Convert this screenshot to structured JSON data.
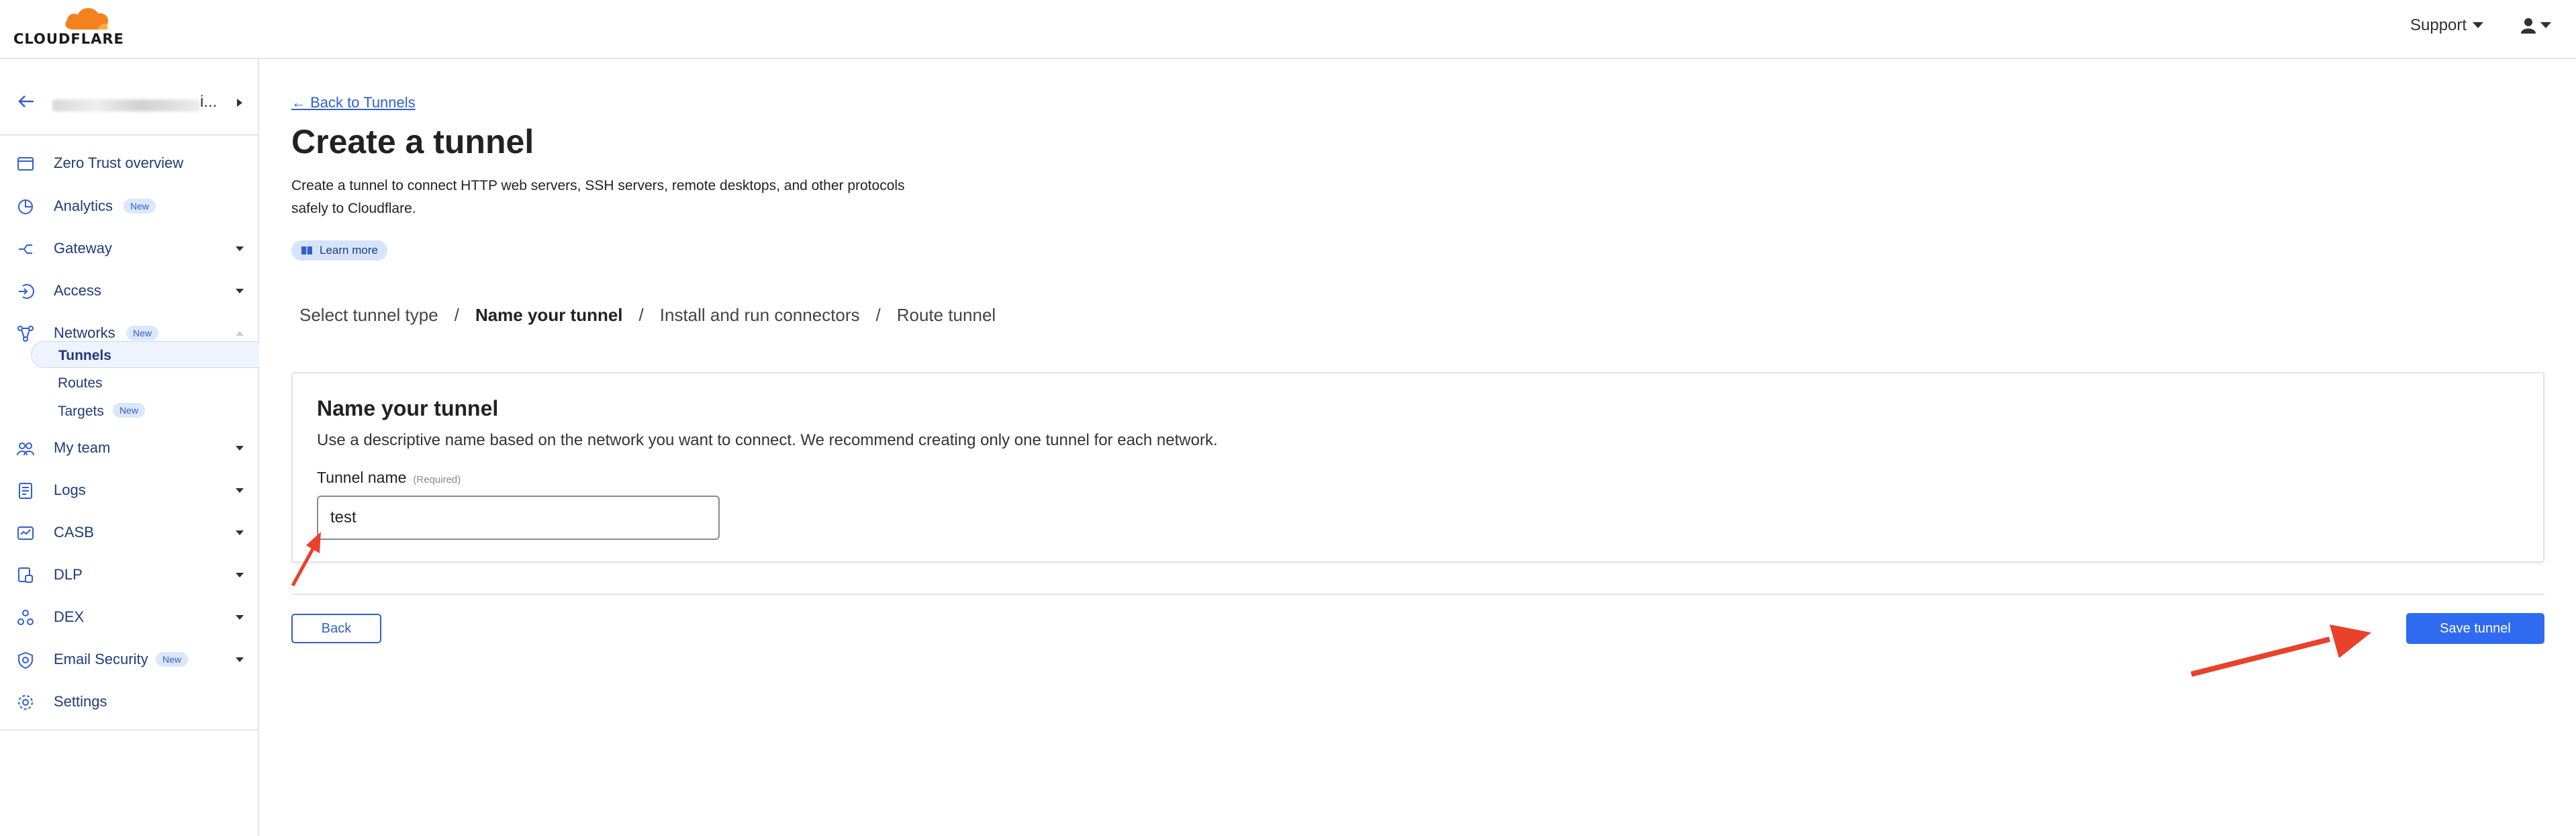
{
  "header": {
    "brand": "CLOUDFLARE",
    "support_label": "Support"
  },
  "sidebar": {
    "account_ellipsis": "i...",
    "items": [
      {
        "label": "Zero Trust overview",
        "icon": "browser-window-icon"
      },
      {
        "label": "Analytics",
        "badge": "New",
        "icon": "analytics-icon"
      },
      {
        "label": "Gateway",
        "icon": "gateway-icon"
      },
      {
        "label": "Access",
        "icon": "access-icon"
      },
      {
        "label": "Networks",
        "badge": "New",
        "icon": "networks-icon",
        "expanded": true
      },
      {
        "label": "My team",
        "icon": "team-icon"
      },
      {
        "label": "Logs",
        "icon": "logs-icon"
      },
      {
        "label": "CASB",
        "icon": "casb-icon"
      },
      {
        "label": "DLP",
        "icon": "dlp-icon"
      },
      {
        "label": "DEX",
        "icon": "dex-icon"
      },
      {
        "label": "Email Security",
        "badge": "New",
        "icon": "email-security-icon"
      },
      {
        "label": "Settings",
        "icon": "settings-icon"
      }
    ],
    "networks_sub": [
      {
        "label": "Tunnels",
        "active": true
      },
      {
        "label": "Routes"
      },
      {
        "label": "Targets",
        "badge": "New"
      }
    ]
  },
  "main": {
    "back_link": "← Back to Tunnels",
    "title": "Create a tunnel",
    "description": "Create a tunnel to connect HTTP web servers, SSH servers, remote desktops, and other protocols safely to Cloudflare.",
    "learn_more": "Learn more",
    "steps": [
      "Select tunnel type",
      "Name your tunnel",
      "Install and run connectors",
      "Route tunnel"
    ],
    "step_separator": "/",
    "current_step": "Name your tunnel",
    "card": {
      "title": "Name your tunnel",
      "description": "Use a descriptive name based on the network you want to connect. We recommend creating only one tunnel for each network.",
      "field_label": "Tunnel name",
      "field_required": "(Required)",
      "field_value": "test"
    },
    "back_button": "Back",
    "save_button": "Save tunnel"
  },
  "colors": {
    "accent": "#2f6bf0",
    "brand_orange": "#f48120",
    "annotation_red": "#e8412c"
  }
}
